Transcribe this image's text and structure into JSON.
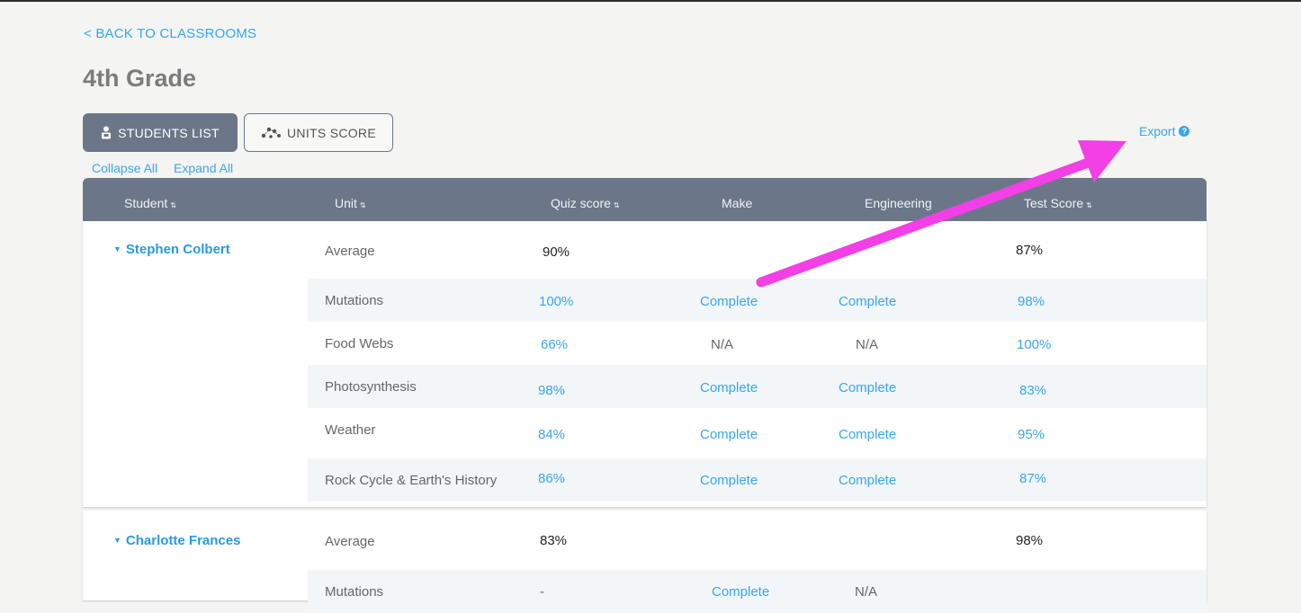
{
  "nav": {
    "back_label": "< BACK TO CLASSROOMS"
  },
  "page": {
    "title": "4th Grade"
  },
  "toolbar": {
    "students_list_label": "STUDENTS LIST",
    "units_score_label": "UNITS SCORE",
    "collapse_all": "Collapse All",
    "expand_all": "Expand All",
    "export_label": "Export",
    "export_help_icon": "?"
  },
  "table": {
    "headers": {
      "student": "Student",
      "unit": "Unit",
      "quiz": "Quiz score",
      "make": "Make",
      "engineering": "Engineering",
      "test": "Test Score"
    },
    "sort_icon": "⇅",
    "caret_icon": "▼",
    "students": [
      {
        "name": "Stephen Colbert",
        "average": {
          "unit": "Average",
          "quiz": "90%",
          "test": "87%"
        },
        "rows": [
          {
            "unit": "Mutations",
            "quiz": "100%",
            "make": "Complete",
            "engineering": "Complete",
            "test": "98%"
          },
          {
            "unit": "Food Webs",
            "quiz": "66%",
            "make": "N/A",
            "engineering": "N/A",
            "test": "100%"
          },
          {
            "unit": "Photosynthesis",
            "quiz": "98%",
            "make": "Complete",
            "engineering": "Complete",
            "test": "83%"
          },
          {
            "unit": "Weather",
            "quiz": "84%",
            "make": "Complete",
            "engineering": "Complete",
            "test": "95%"
          },
          {
            "unit": "Rock Cycle & Earth's History",
            "quiz": "86%",
            "make": "Complete",
            "engineering": "Complete",
            "test": "87%"
          }
        ]
      },
      {
        "name": "Charlotte Frances",
        "average": {
          "unit": "Average",
          "quiz": "83%",
          "test": "98%"
        },
        "rows": [
          {
            "unit": "Mutations",
            "quiz": "-",
            "make": "Complete",
            "engineering": "N/A",
            "test": ""
          }
        ]
      }
    ]
  },
  "annotation": {
    "arrow_color": "#f23fe6"
  },
  "colors": {
    "accent": "#3aa6e6",
    "header_bg": "#6b7789"
  }
}
